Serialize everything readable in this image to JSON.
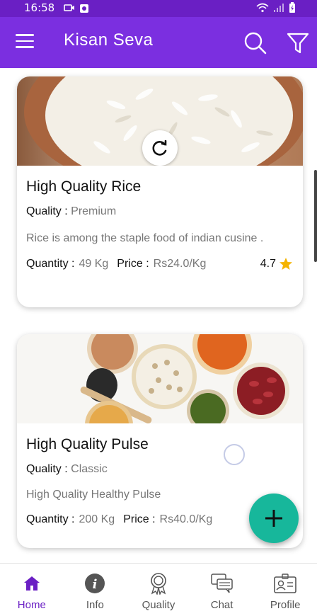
{
  "status": {
    "time": "16:58"
  },
  "app": {
    "title": "Kisan Seva"
  },
  "products": [
    {
      "name": "High Quality Rice",
      "quality_label": "Quality :",
      "quality": "Premium",
      "description": "Rice is among the staple food of indian cusine .",
      "quantity_label": "Quantity :",
      "quantity": "49 Kg",
      "price_label": "Price :",
      "price": "Rs24.0/Kg",
      "rating": "4.7"
    },
    {
      "name": "High Quality Pulse",
      "quality_label": "Quality :",
      "quality": "Classic",
      "description": "High Quality Healthy Pulse",
      "quantity_label": "Quantity :",
      "quantity": "200 Kg",
      "price_label": "Price :",
      "price": "Rs40.0/Kg"
    }
  ],
  "nav": [
    {
      "label": "Home",
      "icon": "home-icon"
    },
    {
      "label": "Info",
      "icon": "info-icon"
    },
    {
      "label": "Quality",
      "icon": "quality-badge-icon"
    },
    {
      "label": "Chat",
      "icon": "chat-icon"
    },
    {
      "label": "Profile",
      "icon": "profile-card-icon"
    }
  ],
  "colors": {
    "primary": "#7b2fe0",
    "fab": "#17b79b",
    "star": "#f5b400"
  }
}
